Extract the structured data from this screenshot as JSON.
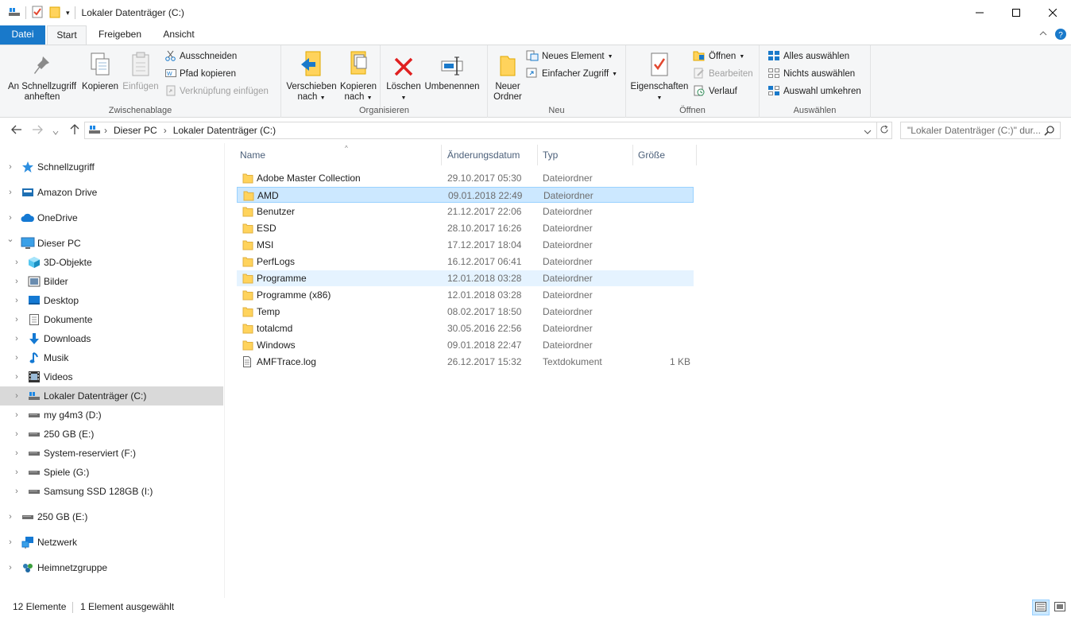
{
  "window": {
    "title": "Lokaler Datenträger (C:)"
  },
  "ribbon": {
    "tabs": [
      "Datei",
      "Start",
      "Freigeben",
      "Ansicht"
    ],
    "groups": {
      "clipboard": {
        "label": "Zwischenablage",
        "pin": "An Schnellzugriff anheften",
        "copy": "Kopieren",
        "paste": "Einfügen",
        "cut": "Ausschneiden",
        "copy_path": "Pfad kopieren",
        "paste_shortcut": "Verknüpfung einfügen"
      },
      "organize": {
        "label": "Organisieren",
        "move_to_1": "Verschieben",
        "move_to_2": "nach",
        "copy_to_1": "Kopieren",
        "copy_to_2": "nach",
        "delete": "Löschen",
        "rename": "Umbenennen"
      },
      "new": {
        "label": "Neu",
        "new_folder_1": "Neuer",
        "new_folder_2": "Ordner",
        "new_item": "Neues Element",
        "easy_access": "Einfacher Zugriff"
      },
      "open": {
        "label": "Öffnen",
        "properties": "Eigenschaften",
        "open": "Öffnen",
        "edit": "Bearbeiten",
        "history": "Verlauf"
      },
      "select": {
        "label": "Auswählen",
        "select_all": "Alles auswählen",
        "select_none": "Nichts auswählen",
        "invert": "Auswahl umkehren"
      }
    }
  },
  "address": {
    "crumbs": [
      "Dieser PC",
      "Lokaler Datenträger (C:)"
    ],
    "search_placeholder": "\"Lokaler Datenträger (C:)\" dur..."
  },
  "nav": [
    {
      "label": "Schnellzugriff",
      "icon": "star-icon"
    },
    {
      "label": "Amazon Drive",
      "icon": "amazon-drive-icon"
    },
    {
      "label": "OneDrive",
      "icon": "cloud-icon"
    },
    {
      "label": "Dieser PC",
      "icon": "computer-icon"
    },
    {
      "label": "3D-Objekte",
      "icon": "cube-icon"
    },
    {
      "label": "Bilder",
      "icon": "pictures-icon"
    },
    {
      "label": "Desktop",
      "icon": "desktop-icon"
    },
    {
      "label": "Dokumente",
      "icon": "document-icon"
    },
    {
      "label": "Downloads",
      "icon": "download-icon"
    },
    {
      "label": "Musik",
      "icon": "music-icon"
    },
    {
      "label": "Videos",
      "icon": "video-icon"
    },
    {
      "label": "Lokaler Datenträger (C:)",
      "icon": "local-disk-icon"
    },
    {
      "label": "my g4m3 (D:)",
      "icon": "drive-icon"
    },
    {
      "label": "250 GB (E:)",
      "icon": "drive-icon"
    },
    {
      "label": "System-reserviert (F:)",
      "icon": "drive-icon"
    },
    {
      "label": "Spiele (G:)",
      "icon": "drive-icon"
    },
    {
      "label": "Samsung SSD 128GB (I:)",
      "icon": "drive-icon"
    },
    {
      "label": "250 GB (E:)",
      "icon": "drive-icon"
    },
    {
      "label": "Netzwerk",
      "icon": "network-icon"
    },
    {
      "label": "Heimnetzgruppe",
      "icon": "homegroup-icon"
    }
  ],
  "columns": [
    "Name",
    "Änderungsdatum",
    "Typ",
    "Größe"
  ],
  "files": [
    {
      "name": "Adobe Master Collection",
      "date": "29.10.2017 05:30",
      "type": "Dateiordner",
      "size": ""
    },
    {
      "name": "AMD",
      "date": "09.01.2018 22:49",
      "type": "Dateiordner",
      "size": ""
    },
    {
      "name": "Benutzer",
      "date": "21.12.2017 22:06",
      "type": "Dateiordner",
      "size": ""
    },
    {
      "name": "ESD",
      "date": "28.10.2017 16:26",
      "type": "Dateiordner",
      "size": ""
    },
    {
      "name": "MSI",
      "date": "17.12.2017 18:04",
      "type": "Dateiordner",
      "size": ""
    },
    {
      "name": "PerfLogs",
      "date": "16.12.2017 06:41",
      "type": "Dateiordner",
      "size": ""
    },
    {
      "name": "Programme",
      "date": "12.01.2018 03:28",
      "type": "Dateiordner",
      "size": ""
    },
    {
      "name": "Programme (x86)",
      "date": "12.01.2018 03:28",
      "type": "Dateiordner",
      "size": ""
    },
    {
      "name": "Temp",
      "date": "08.02.2017 18:50",
      "type": "Dateiordner",
      "size": ""
    },
    {
      "name": "totalcmd",
      "date": "30.05.2016 22:56",
      "type": "Dateiordner",
      "size": ""
    },
    {
      "name": "Windows",
      "date": "09.01.2018 22:47",
      "type": "Dateiordner",
      "size": ""
    },
    {
      "name": "AMFTrace.log",
      "date": "26.12.2017 15:32",
      "type": "Textdokument",
      "size": "1 KB"
    }
  ],
  "status": {
    "count": "12 Elemente",
    "selected": "1 Element ausgewählt"
  },
  "colors": {
    "accent": "#1979ca",
    "selection": "#cce8ff",
    "hover": "#e5f3ff",
    "folder": "#ffd35c"
  }
}
